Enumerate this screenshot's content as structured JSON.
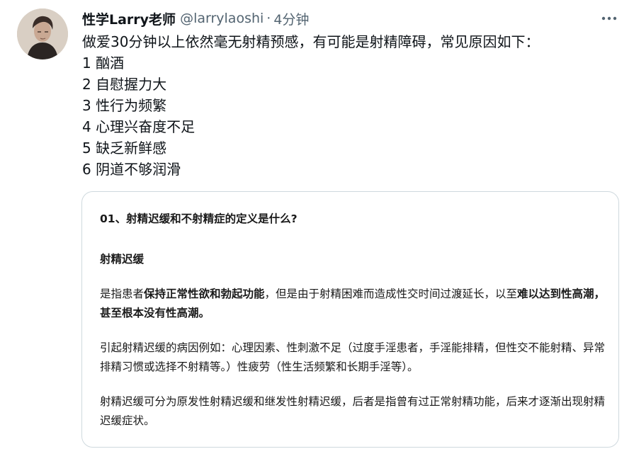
{
  "tweet": {
    "author_name": "性学Larry老师",
    "handle": "@larrylaoshi",
    "separator": "·",
    "time": "4分钟",
    "more_icon": "more-horizontal-icon",
    "lines": [
      "做爱30分钟以上依然毫无射精预感，有可能是射精障碍，常见原因如下：",
      "1 酗酒",
      "2 自慰握力大",
      "3 性行为频繁",
      "4 心理兴奋度不足",
      "5 缺乏新鲜感",
      "6 阴道不够润滑"
    ]
  },
  "card": {
    "title": "01、射精迟缓和不射精症的定义是什么?",
    "subtitle": "射精迟缓",
    "para1": {
      "t1": "是指患者",
      "b1": "保持正常性欲和勃起功能",
      "t2": "，但是由于射精困难而造成性交时间过渡延长，以至",
      "b2": "难以达到性高潮，甚至根本没有性高潮。"
    },
    "para2": "引起射精迟缓的病因例如：心理因素、性刺激不足（过度手淫患者，手淫能排精，但性交不能射精、异常排精习惯或选择不射精等。）性疲劳（性生活频繁和长期手淫等）。",
    "para3": "射精迟缓可分为原发性射精迟缓和继发性射精迟缓，后者是指曾有过正常射精功能，后来才逐渐出现射精迟缓症状。"
  }
}
